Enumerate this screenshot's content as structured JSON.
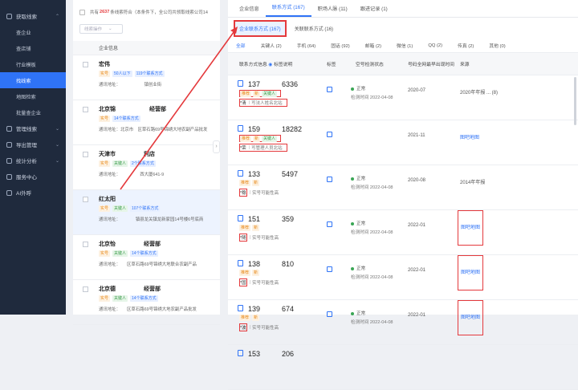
{
  "sidebar": {
    "sections": [
      {
        "label": "获取线索",
        "expanded": true,
        "items": [
          "查企业",
          "查店铺",
          "行业模板",
          "找线索",
          "地图检索",
          "批量查企业"
        ],
        "active": 3
      },
      {
        "label": "管理线索"
      },
      {
        "label": "导出管理"
      },
      {
        "label": "统计分析"
      },
      {
        "label": "服务中心"
      },
      {
        "label": "AI外呼"
      }
    ]
  },
  "left": {
    "summary_prefix": "共有",
    "summary_count": "2637",
    "summary_suffix": "条线索符合（本条件下，全公司共领取线索公司14",
    "filter_label": "线索操作",
    "column_header": "企业信息",
    "cards": [
      {
        "name": "宏伟",
        "tags": [
          "实号",
          "50人以下",
          "119个联系方式"
        ],
        "addr": "通讯地址：　　　　　　镇创业街"
      },
      {
        "name": "北京锦　　　　　　经营部",
        "tags": [
          "实号",
          "14个联系方式"
        ],
        "addr": "通讯地址：北京市　区草石路69号锦绣大地农副产品批发"
      },
      {
        "name": "天津市　　　　　利店",
        "tags": [
          "实号",
          "关键人",
          "2个联系方式"
        ],
        "addr": "通讯地址：　　　　　西大厦641-9"
      },
      {
        "name": "红太阳",
        "tags": [
          "实号",
          "关键人",
          "107个联系方式"
        ],
        "addr": "通讯地址：　　　　镇县龙关镇龙新家园14号楼6号底商"
      },
      {
        "name": "北京怡　　　　　经营部",
        "tags": [
          "实号",
          "关键人",
          "14个联系方式"
        ],
        "addr": "通讯地址：　　区草石路69号锦绣大地联合农副产品"
      },
      {
        "name": "北京德　　　　　经营部",
        "tags": [
          "实号",
          "关键人",
          "14个联系方式"
        ],
        "addr": "通讯地址：　　区草石路69号锦绣大地农副产品批发"
      }
    ]
  },
  "right": {
    "tabs": [
      "企业信息",
      "联系方式 (167)",
      "职场人脉 (11)",
      "跟进记录 (1)"
    ],
    "active_tab": 1,
    "subtabs": [
      "企业联系方式 (167)",
      "关联联系方式 (16)"
    ],
    "types": [
      "全部",
      "关键人 (2)",
      "手机 (64)",
      "固话 (92)",
      "邮箱 (2)",
      "微信 (1)",
      "QQ (2)",
      "传真 (2)",
      "其他 (0)"
    ],
    "headers": [
      "联系方式信息",
      "标签说明",
      "标签",
      "空号检测状态",
      "号码全网最早出现时间",
      "来源"
    ],
    "rows": [
      {
        "phone": "137　　　6336",
        "tags": [
          "推荐",
          "新",
          "关键人"
        ],
        "note_name": "*清",
        "note": "写法人姓名北站",
        "status": "正常",
        "checked": "检测时间 2022-04-08",
        "date": "2020-07",
        "source": "2020年年报 ... (8)"
      },
      {
        "phone": "159　　　18282",
        "tags": [
          "推荐",
          "新",
          "关键人"
        ],
        "note_name": "*荣",
        "note": "写管理人员北站",
        "status": "",
        "checked": "",
        "date": "2021-11",
        "source": "图吧地图"
      },
      {
        "phone": "133　　　5497",
        "tags": [
          "推荐",
          "新"
        ],
        "note_name": "*稳",
        "note": "实号可能性高",
        "status": "正常",
        "checked": "检测时间 2022-04-08",
        "date": "2020-08",
        "source": "2014年年报"
      },
      {
        "phone": "151　　　359",
        "tags": [
          "推荐",
          "新"
        ],
        "note_name": "*随",
        "note": "实号可能性高",
        "status": "正常",
        "checked": "检测时间 2022-04-08",
        "date": "2022-01",
        "source": "图吧地图"
      },
      {
        "phone": "138　　　810",
        "tags": [
          "推荐",
          "新"
        ],
        "note_name": "*国",
        "note": "实号可能性高",
        "status": "正常",
        "checked": "检测时间 2022-04-08",
        "date": "2022-01",
        "source": "图吧地图"
      },
      {
        "phone": "139　　　674",
        "tags": [
          "推荐",
          "新"
        ],
        "note_name": "*波",
        "note": "实号可能性高",
        "status": "正常",
        "checked": "检测时间 2022-04-08",
        "date": "2022-01",
        "source": "图吧地图"
      },
      {
        "phone": "153　　　206",
        "tags": [],
        "note_name": "",
        "note": "",
        "status": "",
        "checked": "",
        "date": "",
        "source": ""
      }
    ]
  },
  "colors": {
    "accent": "#2f73f6",
    "highlight": "#e4393c",
    "sidebar": "#1f2a3d"
  }
}
